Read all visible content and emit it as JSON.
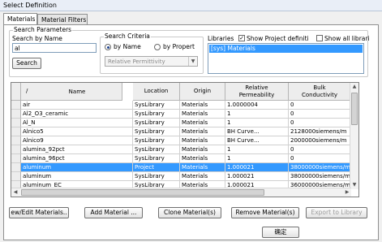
{
  "window": {
    "title": "Select Definition"
  },
  "tabs": [
    {
      "label": "Materials"
    },
    {
      "label": "Material Filters"
    }
  ],
  "search_parameters": {
    "group_label": "Search Parameters",
    "by_name_label": "Search by Name",
    "query_value": "al",
    "search_button": "Search"
  },
  "search_criteria": {
    "group_label": "Search Criteria",
    "by_name": "by Name",
    "by_property": "by Propert",
    "selected": "by Name",
    "property_select": "Relative Permittivity"
  },
  "libraries": {
    "label": "Libraries",
    "show_project_definitions": "Show Project definiti",
    "show_project_checked": true,
    "show_all_libraries": "Show all librari",
    "show_all_checked": false,
    "items": [
      "[sys] Materials"
    ]
  },
  "table": {
    "columns": [
      {
        "label": "/"
      },
      {
        "label": "Name"
      },
      {
        "label": "Location"
      },
      {
        "label": "Origin"
      },
      {
        "label": "Relative\nPermeability"
      },
      {
        "label": "Bulk\nConductivity"
      }
    ],
    "rows": [
      {
        "name": "air",
        "location": "SysLibrary",
        "origin": "Materials",
        "permeability": "1.0000004",
        "conductivity": "0",
        "selected": false
      },
      {
        "name": "Al2_O3_ceramic",
        "location": "SysLibrary",
        "origin": "Materials",
        "permeability": "1",
        "conductivity": "0",
        "selected": false
      },
      {
        "name": "Al_N",
        "location": "SysLibrary",
        "origin": "Materials",
        "permeability": "1",
        "conductivity": "0",
        "selected": false
      },
      {
        "name": "Alnico5",
        "location": "SysLibrary",
        "origin": "Materials",
        "permeability": "BH Curve...",
        "conductivity": "2128000siemens/m",
        "selected": false
      },
      {
        "name": "Alnico9",
        "location": "SysLibrary",
        "origin": "Materials",
        "permeability": "BH Curve...",
        "conductivity": "2000000siemens/m",
        "selected": false
      },
      {
        "name": "alumina_92pct",
        "location": "SysLibrary",
        "origin": "Materials",
        "permeability": "1",
        "conductivity": "0",
        "selected": false
      },
      {
        "name": "alumina_96pct",
        "location": "SysLibrary",
        "origin": "Materials",
        "permeability": "1",
        "conductivity": "0",
        "selected": false
      },
      {
        "name": "aluminum",
        "location": "Project",
        "origin": "Materials",
        "permeability": "1.000021",
        "conductivity": "38000000siemens/m",
        "selected": true
      },
      {
        "name": "aluminum",
        "location": "SysLibrary",
        "origin": "Materials",
        "permeability": "1.000021",
        "conductivity": "38000000siemens/m",
        "selected": false
      },
      {
        "name": "aluminum_EC",
        "location": "SysLibrary",
        "origin": "Materials",
        "permeability": "1.000021",
        "conductivity": "36000000siemens/m",
        "selected": false
      }
    ]
  },
  "buttons": {
    "view_edit": "ew/Edit Materials..",
    "add": "Add Material ...",
    "clone": "Clone Material(s)",
    "remove": "Remove Material(s)",
    "export": "Export to Library",
    "ok": "确定"
  },
  "colors": {
    "selection": "#3399ff",
    "dialog_bg": "#f0f0f0",
    "header_bg": "#ededed"
  }
}
